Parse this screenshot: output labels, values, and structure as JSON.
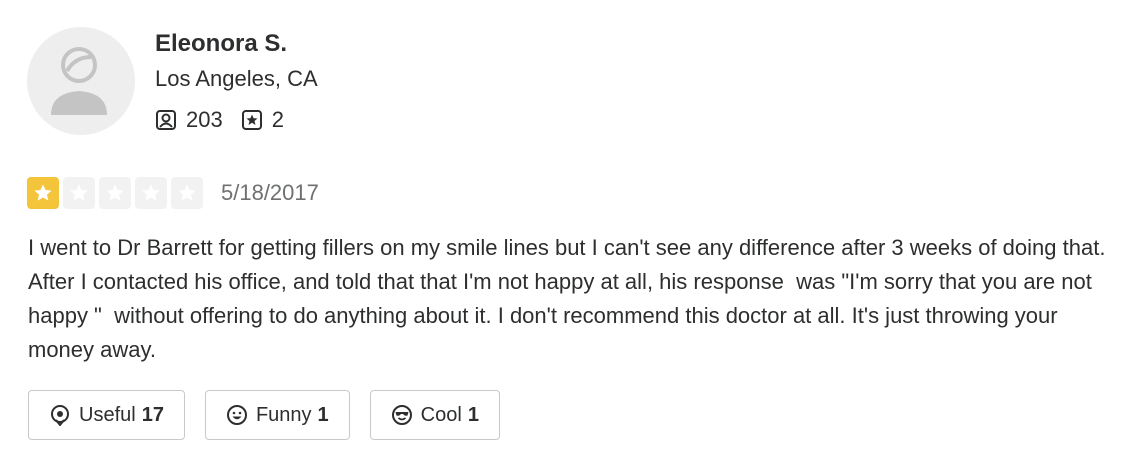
{
  "user": {
    "name": "Eleonora S.",
    "location": "Los Angeles, CA",
    "stats": [
      {
        "icon": "friends-icon",
        "value": "203"
      },
      {
        "icon": "review-star-icon",
        "value": "2"
      }
    ]
  },
  "review": {
    "rating": 1,
    "max_rating": 5,
    "star_color_filled": "#f4c43a",
    "star_color_empty": "#f2f2f2",
    "date": "5/18/2017",
    "text": "I went to Dr Barrett for getting fillers on my smile lines but I can't see any difference after 3 weeks of doing that. After I contacted his office, and told that that I'm not happy at all, his response  was \"I'm sorry that you are not happy \"  without offering to do anything about it. I don't recommend this doctor at all. It's just throwing your money away."
  },
  "reactions": [
    {
      "icon": "useful-icon",
      "label": "Useful",
      "count": "17"
    },
    {
      "icon": "funny-icon",
      "label": "Funny",
      "count": "1"
    },
    {
      "icon": "cool-icon",
      "label": "Cool",
      "count": "1"
    }
  ]
}
